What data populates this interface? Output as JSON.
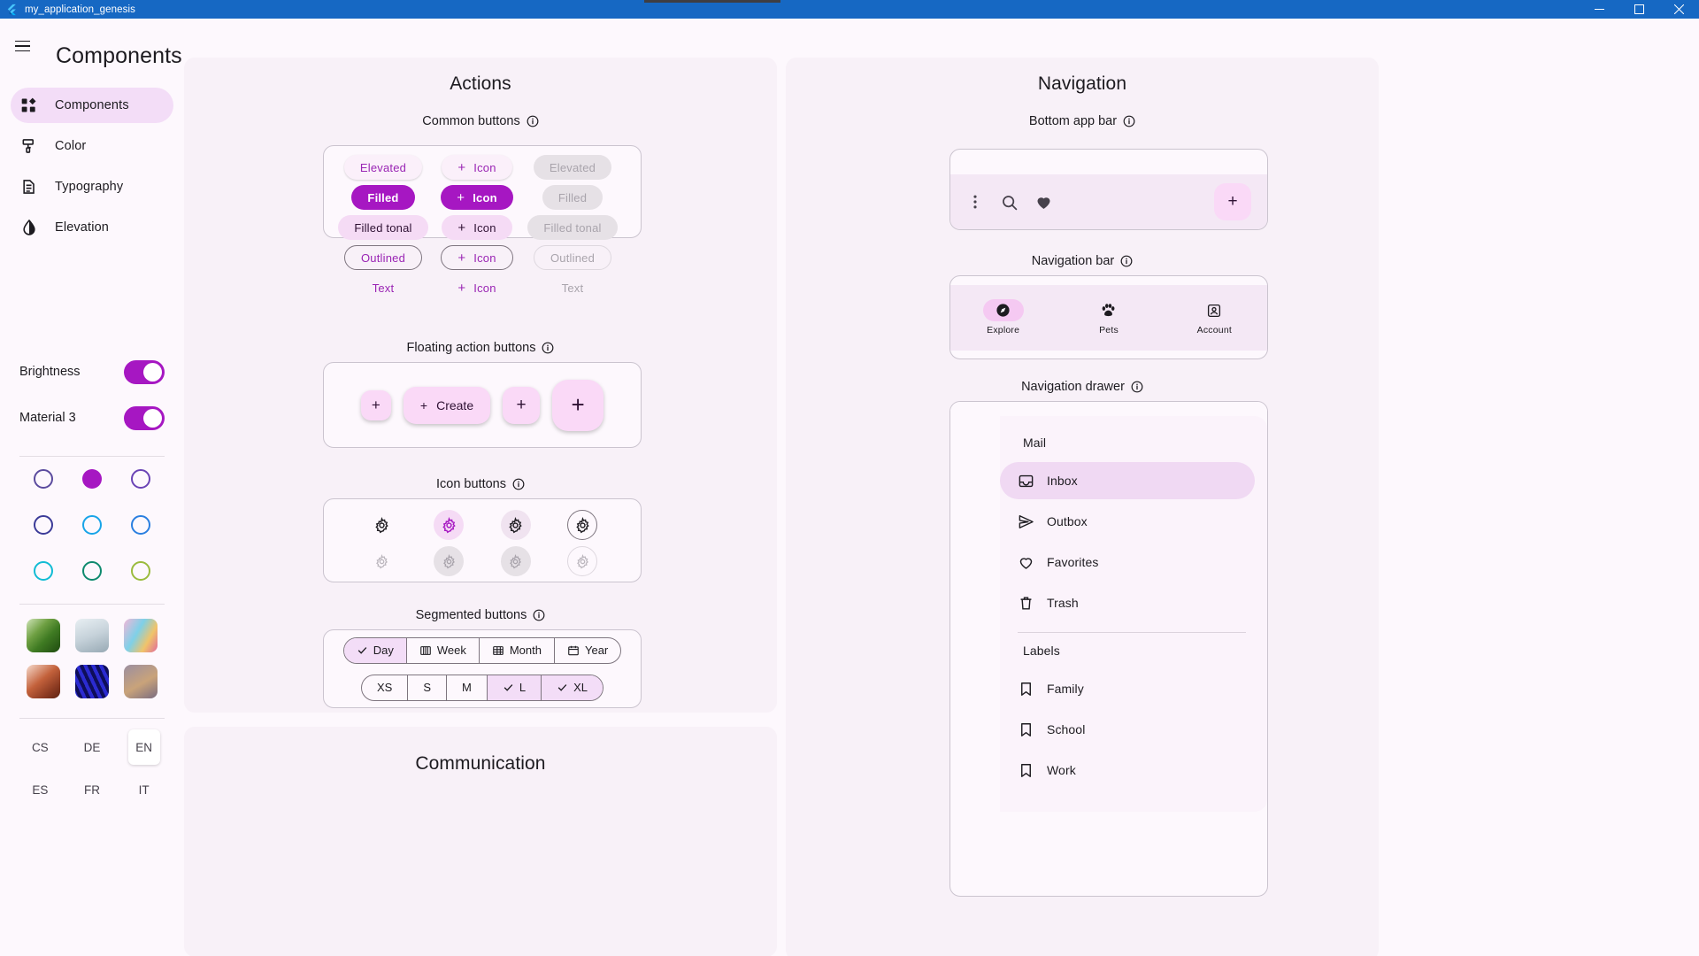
{
  "window": {
    "title": "my_application_genesis",
    "controls": {
      "minimize": "minimize-icon",
      "maximize": "maximize-icon",
      "close": "close-icon"
    }
  },
  "header": {
    "title": "Components",
    "menu_icon": "hamburger-icon"
  },
  "sidebar": {
    "items": [
      {
        "label": "Components",
        "icon": "components-icon",
        "active": true
      },
      {
        "label": "Color",
        "icon": "color-icon",
        "active": false
      },
      {
        "label": "Typography",
        "icon": "typography-icon",
        "active": false
      },
      {
        "label": "Elevation",
        "icon": "elevation-icon",
        "active": false
      }
    ],
    "switches": [
      {
        "label": "Brightness",
        "on": true
      },
      {
        "label": "Material 3",
        "on": true
      }
    ],
    "color_seeds": [
      {
        "name": "purple-seed",
        "color": "#5B4B9E",
        "selected": false
      },
      {
        "name": "magenta-seed",
        "color": "#A617C2",
        "selected": true
      },
      {
        "name": "violet-seed",
        "color": "#6A43B5",
        "selected": false
      },
      {
        "name": "indigo-seed",
        "color": "#3B3B98",
        "selected": false
      },
      {
        "name": "light-blue-seed",
        "color": "#18A4E8",
        "selected": false
      },
      {
        "name": "blue-seed",
        "color": "#2A7FE0",
        "selected": false
      },
      {
        "name": "cyan-seed",
        "color": "#11BCD4",
        "selected": false
      },
      {
        "name": "teal-seed",
        "color": "#0E8A6E",
        "selected": false
      },
      {
        "name": "lime-seed",
        "color": "#9ABB3C",
        "selected": false
      }
    ],
    "image_seeds": [
      {
        "name": "leaves-thumb",
        "c1": "#CFE4B8",
        "c2": "#3E7A22",
        "c3": "#1F4A10"
      },
      {
        "name": "dandelion-thumb",
        "c1": "#DDE6EC",
        "c2": "#B9C6CE",
        "c3": "#8FA3AE"
      },
      {
        "name": "bubbles-thumb",
        "c1": "#F3B7D8",
        "c2": "#7ED0E8",
        "c3": "#F0C46A"
      },
      {
        "name": "coral-thumb",
        "c1": "#F6DACC",
        "c2": "#8C3B22",
        "c3": "#5E2211"
      },
      {
        "name": "zebra-thumb",
        "c1": "#2B2BD0",
        "c2": "#0E0E5A",
        "c3": "#4545EE"
      },
      {
        "name": "sand-thumb",
        "c1": "#9B8EA0",
        "c2": "#C9A37A",
        "c3": "#7A6C80"
      }
    ],
    "languages": [
      {
        "code": "CS",
        "selected": false
      },
      {
        "code": "DE",
        "selected": false
      },
      {
        "code": "EN",
        "selected": true
      },
      {
        "code": "ES",
        "selected": false
      },
      {
        "code": "FR",
        "selected": false
      },
      {
        "code": "IT",
        "selected": false
      }
    ]
  },
  "actions": {
    "title": "Actions",
    "common_buttons": {
      "heading": "Common buttons",
      "rows": [
        {
          "label": "Elevated",
          "icon_label": "Icon",
          "disabled_label": "Elevated",
          "style": "elevated"
        },
        {
          "label": "Filled",
          "icon_label": "Icon",
          "disabled_label": "Filled",
          "style": "filled"
        },
        {
          "label": "Filled tonal",
          "icon_label": "Icon",
          "disabled_label": "Filled tonal",
          "style": "tonal"
        },
        {
          "label": "Outlined",
          "icon_label": "Icon",
          "disabled_label": "Outlined",
          "style": "outlined"
        },
        {
          "label": "Text",
          "icon_label": "Icon",
          "disabled_label": "Text",
          "style": "text"
        }
      ]
    },
    "fab": {
      "heading": "Floating action buttons",
      "small_label": "+",
      "extended_label": "Create",
      "extended_icon": "+",
      "medium_label": "+",
      "large_label": "+"
    },
    "icon_buttons": {
      "heading": "Icon buttons",
      "variants": [
        "standard",
        "tonal",
        "filled",
        "outlined"
      ]
    },
    "segmented": {
      "heading": "Segmented buttons",
      "row1": [
        {
          "label": "Day",
          "icon": "check-icon",
          "selected": true
        },
        {
          "label": "Week",
          "icon": "week-icon",
          "selected": false
        },
        {
          "label": "Month",
          "icon": "month-icon",
          "selected": false
        },
        {
          "label": "Year",
          "icon": "calendar-icon",
          "selected": false
        }
      ],
      "row2": [
        {
          "label": "XS",
          "selected": false
        },
        {
          "label": "S",
          "selected": false
        },
        {
          "label": "M",
          "selected": false
        },
        {
          "label": "L",
          "selected": true
        },
        {
          "label": "XL",
          "selected": true
        }
      ]
    }
  },
  "communication": {
    "title": "Communication"
  },
  "navigation": {
    "title": "Navigation",
    "bottom_app_bar": {
      "heading": "Bottom app bar",
      "icons": [
        "more-vert-icon",
        "search-icon",
        "heart-icon"
      ],
      "fab_label": "+"
    },
    "navigation_bar": {
      "heading": "Navigation bar",
      "destinations": [
        {
          "label": "Explore",
          "icon": "explore-icon",
          "active": true
        },
        {
          "label": "Pets",
          "icon": "pets-icon",
          "active": false
        },
        {
          "label": "Account",
          "icon": "account-icon",
          "active": false
        }
      ]
    },
    "navigation_drawer": {
      "heading": "Navigation drawer",
      "groups": [
        {
          "title": "Mail",
          "items": [
            {
              "label": "Inbox",
              "icon": "inbox-icon",
              "active": true
            },
            {
              "label": "Outbox",
              "icon": "outbox-icon",
              "active": false
            },
            {
              "label": "Favorites",
              "icon": "heart-outline-icon",
              "active": false
            },
            {
              "label": "Trash",
              "icon": "trash-icon",
              "active": false
            }
          ]
        },
        {
          "title": "Labels",
          "items": [
            {
              "label": "Family",
              "icon": "bookmark-icon",
              "active": false
            },
            {
              "label": "School",
              "icon": "bookmark-icon",
              "active": false
            },
            {
              "label": "Work",
              "icon": "bookmark-icon",
              "active": false
            }
          ]
        }
      ]
    }
  },
  "colors": {
    "accent": "#A617C2",
    "accent_text": "#9A25B4",
    "tonal_bg": "#F5DBF5",
    "panel_bg": "#F8F1F8",
    "titlebar": "#1668C3"
  }
}
